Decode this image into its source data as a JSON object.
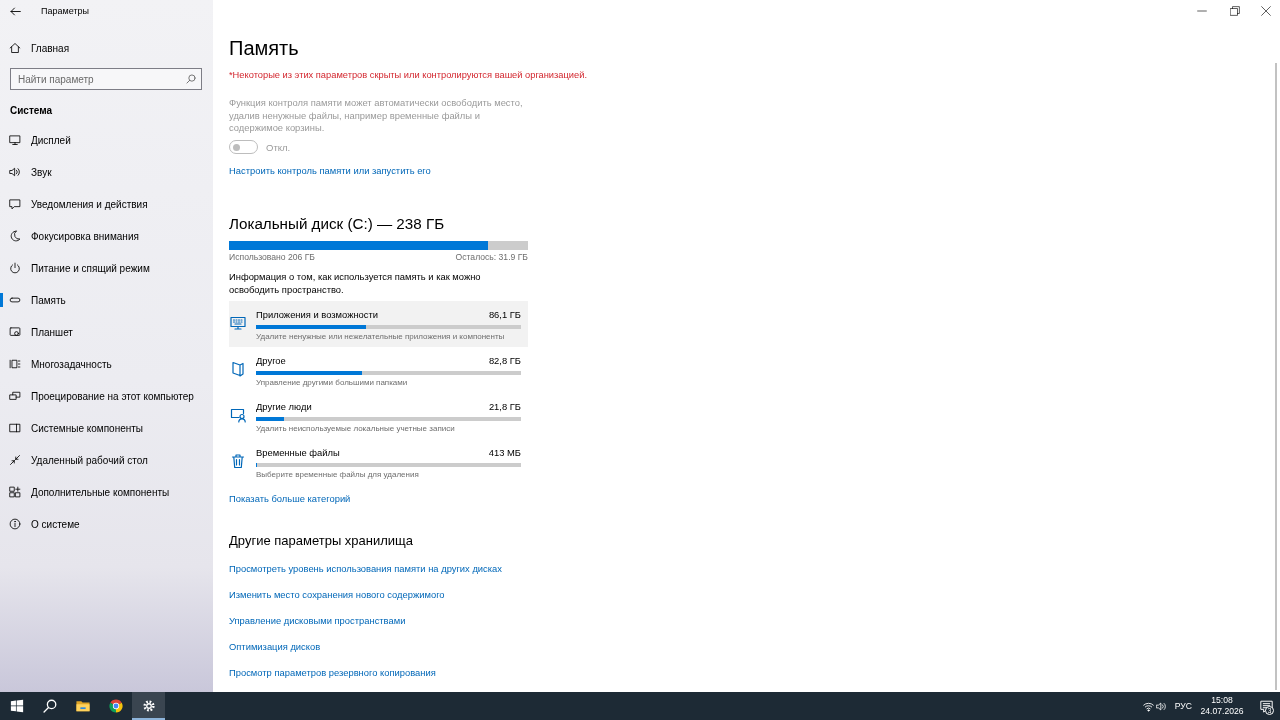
{
  "window": {
    "title": "Параметры"
  },
  "sidebar": {
    "home": {
      "label": "Главная"
    },
    "search": {
      "placeholder": "Найти параметр"
    },
    "section_title": "Система",
    "items": [
      {
        "label": "Дисплей",
        "selected": false
      },
      {
        "label": "Звук",
        "selected": false
      },
      {
        "label": "Уведомления и действия",
        "selected": false
      },
      {
        "label": "Фокусировка внимания",
        "selected": false
      },
      {
        "label": "Питание и спящий режим",
        "selected": false
      },
      {
        "label": "Память",
        "selected": true
      },
      {
        "label": "Планшет",
        "selected": false
      },
      {
        "label": "Многозадачность",
        "selected": false
      },
      {
        "label": "Проецирование на этот компьютер",
        "selected": false
      },
      {
        "label": "Системные компоненты",
        "selected": false
      },
      {
        "label": "Удаленный рабочий стол",
        "selected": false
      },
      {
        "label": "Дополнительные компоненты",
        "selected": false
      },
      {
        "label": "О системе",
        "selected": false
      }
    ]
  },
  "page": {
    "title": "Память",
    "policy_note": "*Некоторые из этих параметров скрыты или контролируются вашей организацией.",
    "storage_sense": {
      "description": "Функция контроля памяти может автоматически освободить место, удалив ненужные файлы, например временные файлы и содержимое корзины.",
      "disabled": true,
      "toggle": {
        "on": false,
        "label": "Откл."
      },
      "link": "Настроить контроль памяти или запустить его"
    },
    "disk": {
      "title": "Локальный диск (C:) — 238 ГБ",
      "level": 0.866,
      "used": "Использовано 206 ГБ",
      "free": "Осталось: 31.9 ГБ",
      "info": "Информация о том, как используется память и как можно освободить пространство."
    },
    "categories": [
      {
        "name": "Приложения и возможности",
        "size": "86,1 ГБ",
        "level": 0.415,
        "description": "Удалите ненужные или нежелательные приложения и компоненты",
        "highlighted": true
      },
      {
        "name": "Другое",
        "size": "82,8 ГБ",
        "level": 0.4,
        "description": "Управление другими большими папками",
        "highlighted": false
      },
      {
        "name": "Другие люди",
        "size": "21,8 ГБ",
        "level": 0.106,
        "description": "Удалить неиспользуемые локальные учетные записи",
        "highlighted": false
      },
      {
        "name": "Временные файлы",
        "size": "413 МБ",
        "level": 0.004,
        "description": "Выберите временные файлы для удаления",
        "highlighted": false
      }
    ],
    "more_link": "Показать больше категорий",
    "other_settings": {
      "title": "Другие параметры хранилища",
      "links": [
        "Просмотреть уровень использования памяти на других дисках",
        "Изменить место сохранения нового содержимого",
        "Управление дисковыми пространствами",
        "Оптимизация дисков",
        "Просмотр параметров резервного копирования"
      ]
    }
  },
  "taskbar": {
    "apps": [
      {
        "kind": "start",
        "active": false
      },
      {
        "kind": "search",
        "active": false
      },
      {
        "kind": "explorer",
        "active": false
      },
      {
        "kind": "browser",
        "active": false
      },
      {
        "kind": "settings",
        "active": true
      }
    ],
    "tray": {
      "language": "РУС",
      "time": "15:08",
      "date": "24.07.2026",
      "notification_count": "3"
    }
  }
}
